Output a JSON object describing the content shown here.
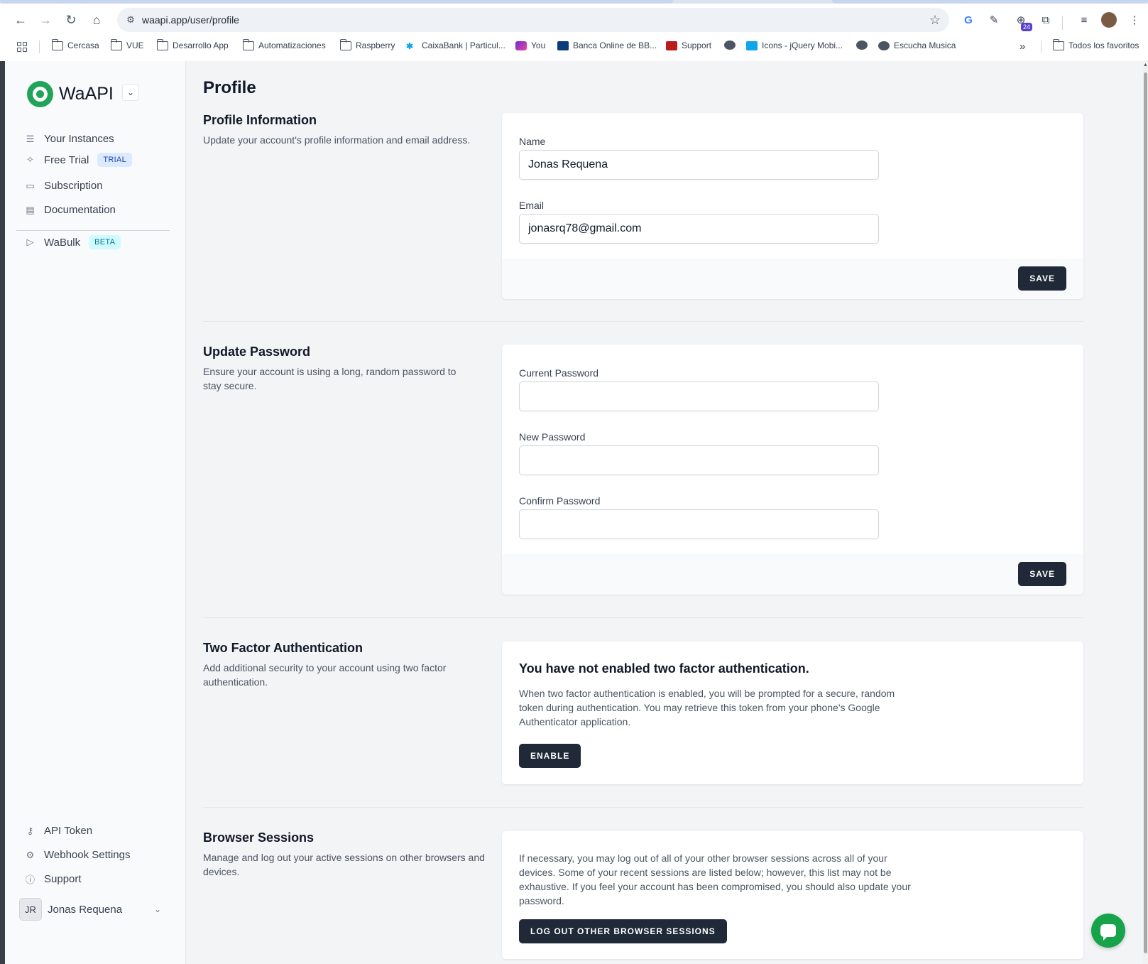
{
  "browser": {
    "url": "waapi.app/user/profile",
    "extension_badge": "24",
    "bookmarks": [
      "Cercasa",
      "VUE",
      "Desarrollo App",
      "Automatizaciones",
      "Raspberry",
      "CaixaBank | Particul...",
      "You",
      "Banca Online de BB...",
      "Support",
      "Icons - jQuery Mobi...",
      "Escucha Musica"
    ],
    "bookmarks_overflow": "»",
    "all_bookmarks": "Todos los favoritos"
  },
  "sidebar": {
    "brand": "WaAPI",
    "items": [
      {
        "label": "Your Instances",
        "icon": "server-icon"
      },
      {
        "label": "Free Trial",
        "icon": "sparkles-icon",
        "badge": "TRIAL"
      },
      {
        "label": "Subscription",
        "icon": "credit-card-icon"
      },
      {
        "label": "Documentation",
        "icon": "document-icon"
      }
    ],
    "wabulk": {
      "label": "WaBulk",
      "icon": "send-icon",
      "badge": "BETA"
    },
    "bottom_items": [
      {
        "label": "API Token",
        "icon": "key-icon"
      },
      {
        "label": "Webhook Settings",
        "icon": "gear-icon"
      },
      {
        "label": "Support",
        "icon": "info-icon"
      }
    ],
    "user": {
      "initials": "JR",
      "name": "Jonas Requena"
    }
  },
  "main": {
    "title": "Profile",
    "profile_info": {
      "title": "Profile Information",
      "description": "Update your account's profile information and email address.",
      "name_label": "Name",
      "name_value": "Jonas Requena",
      "email_label": "Email",
      "email_value": "jonasrq78@gmail.com",
      "save": "SAVE"
    },
    "password": {
      "title": "Update Password",
      "description": "Ensure your account is using a long, random password to stay secure.",
      "current_label": "Current Password",
      "new_label": "New Password",
      "confirm_label": "Confirm Password",
      "save": "SAVE"
    },
    "two_factor": {
      "title": "Two Factor Authentication",
      "description": "Add additional security to your account using two factor authentication.",
      "heading": "You have not enabled two factor authentication.",
      "text": "When two factor authentication is enabled, you will be prompted for a secure, random token during authentication. You may retrieve this token from your phone's Google Authenticator application.",
      "enable": "ENABLE"
    },
    "sessions": {
      "title": "Browser Sessions",
      "description": "Manage and log out your active sessions on other browsers and devices.",
      "text": "If necessary, you may log out of all of your other browser sessions across all of your devices. Some of your recent sessions are listed below; however, this list may not be exhaustive. If you feel your account has been compromised, you should also update your password.",
      "logout": "LOG OUT OTHER BROWSER SESSIONS"
    }
  }
}
